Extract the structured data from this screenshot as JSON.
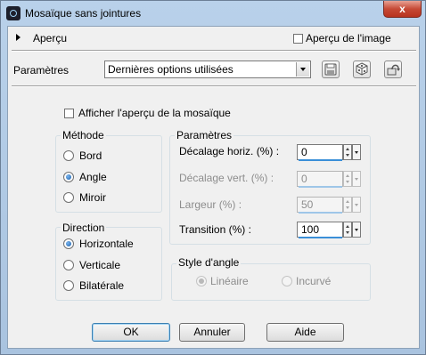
{
  "window": {
    "title": "Mosaïque sans jointures",
    "close_label": "x"
  },
  "preview": {
    "label": "Aperçu",
    "show_image_label": "Aperçu de l'image"
  },
  "presets": {
    "label": "Paramètres",
    "selected": "Dernières options utilisées"
  },
  "show_preview_label": "Afficher l'aperçu de la mosaïque",
  "method": {
    "title": "Méthode",
    "options": [
      "Bord",
      "Angle",
      "Miroir"
    ],
    "selected": "Angle"
  },
  "direction": {
    "title": "Direction",
    "options": [
      "Horizontale",
      "Verticale",
      "Bilatérale"
    ],
    "selected": "Horizontale"
  },
  "params": {
    "title": "Paramètres",
    "h_offset": {
      "label": "Décalage horiz. (%) :",
      "value": "0",
      "enabled": true
    },
    "v_offset": {
      "label": "Décalage vert. (%) :",
      "value": "0",
      "enabled": false
    },
    "width": {
      "label": "Largeur (%) :",
      "value": "50",
      "enabled": false
    },
    "transition": {
      "label": "Transition (%) :",
      "value": "100",
      "enabled": true
    }
  },
  "corner_style": {
    "title": "Style d'angle",
    "options": [
      "Linéaire",
      "Incurvé"
    ],
    "selected": "Linéaire",
    "enabled": false
  },
  "buttons": {
    "ok": "OK",
    "cancel": "Annuler",
    "help": "Aide"
  },
  "colors": {
    "accent": "#3a8fd8",
    "title_bar": "#b9d1ea",
    "close": "#c64a36"
  }
}
